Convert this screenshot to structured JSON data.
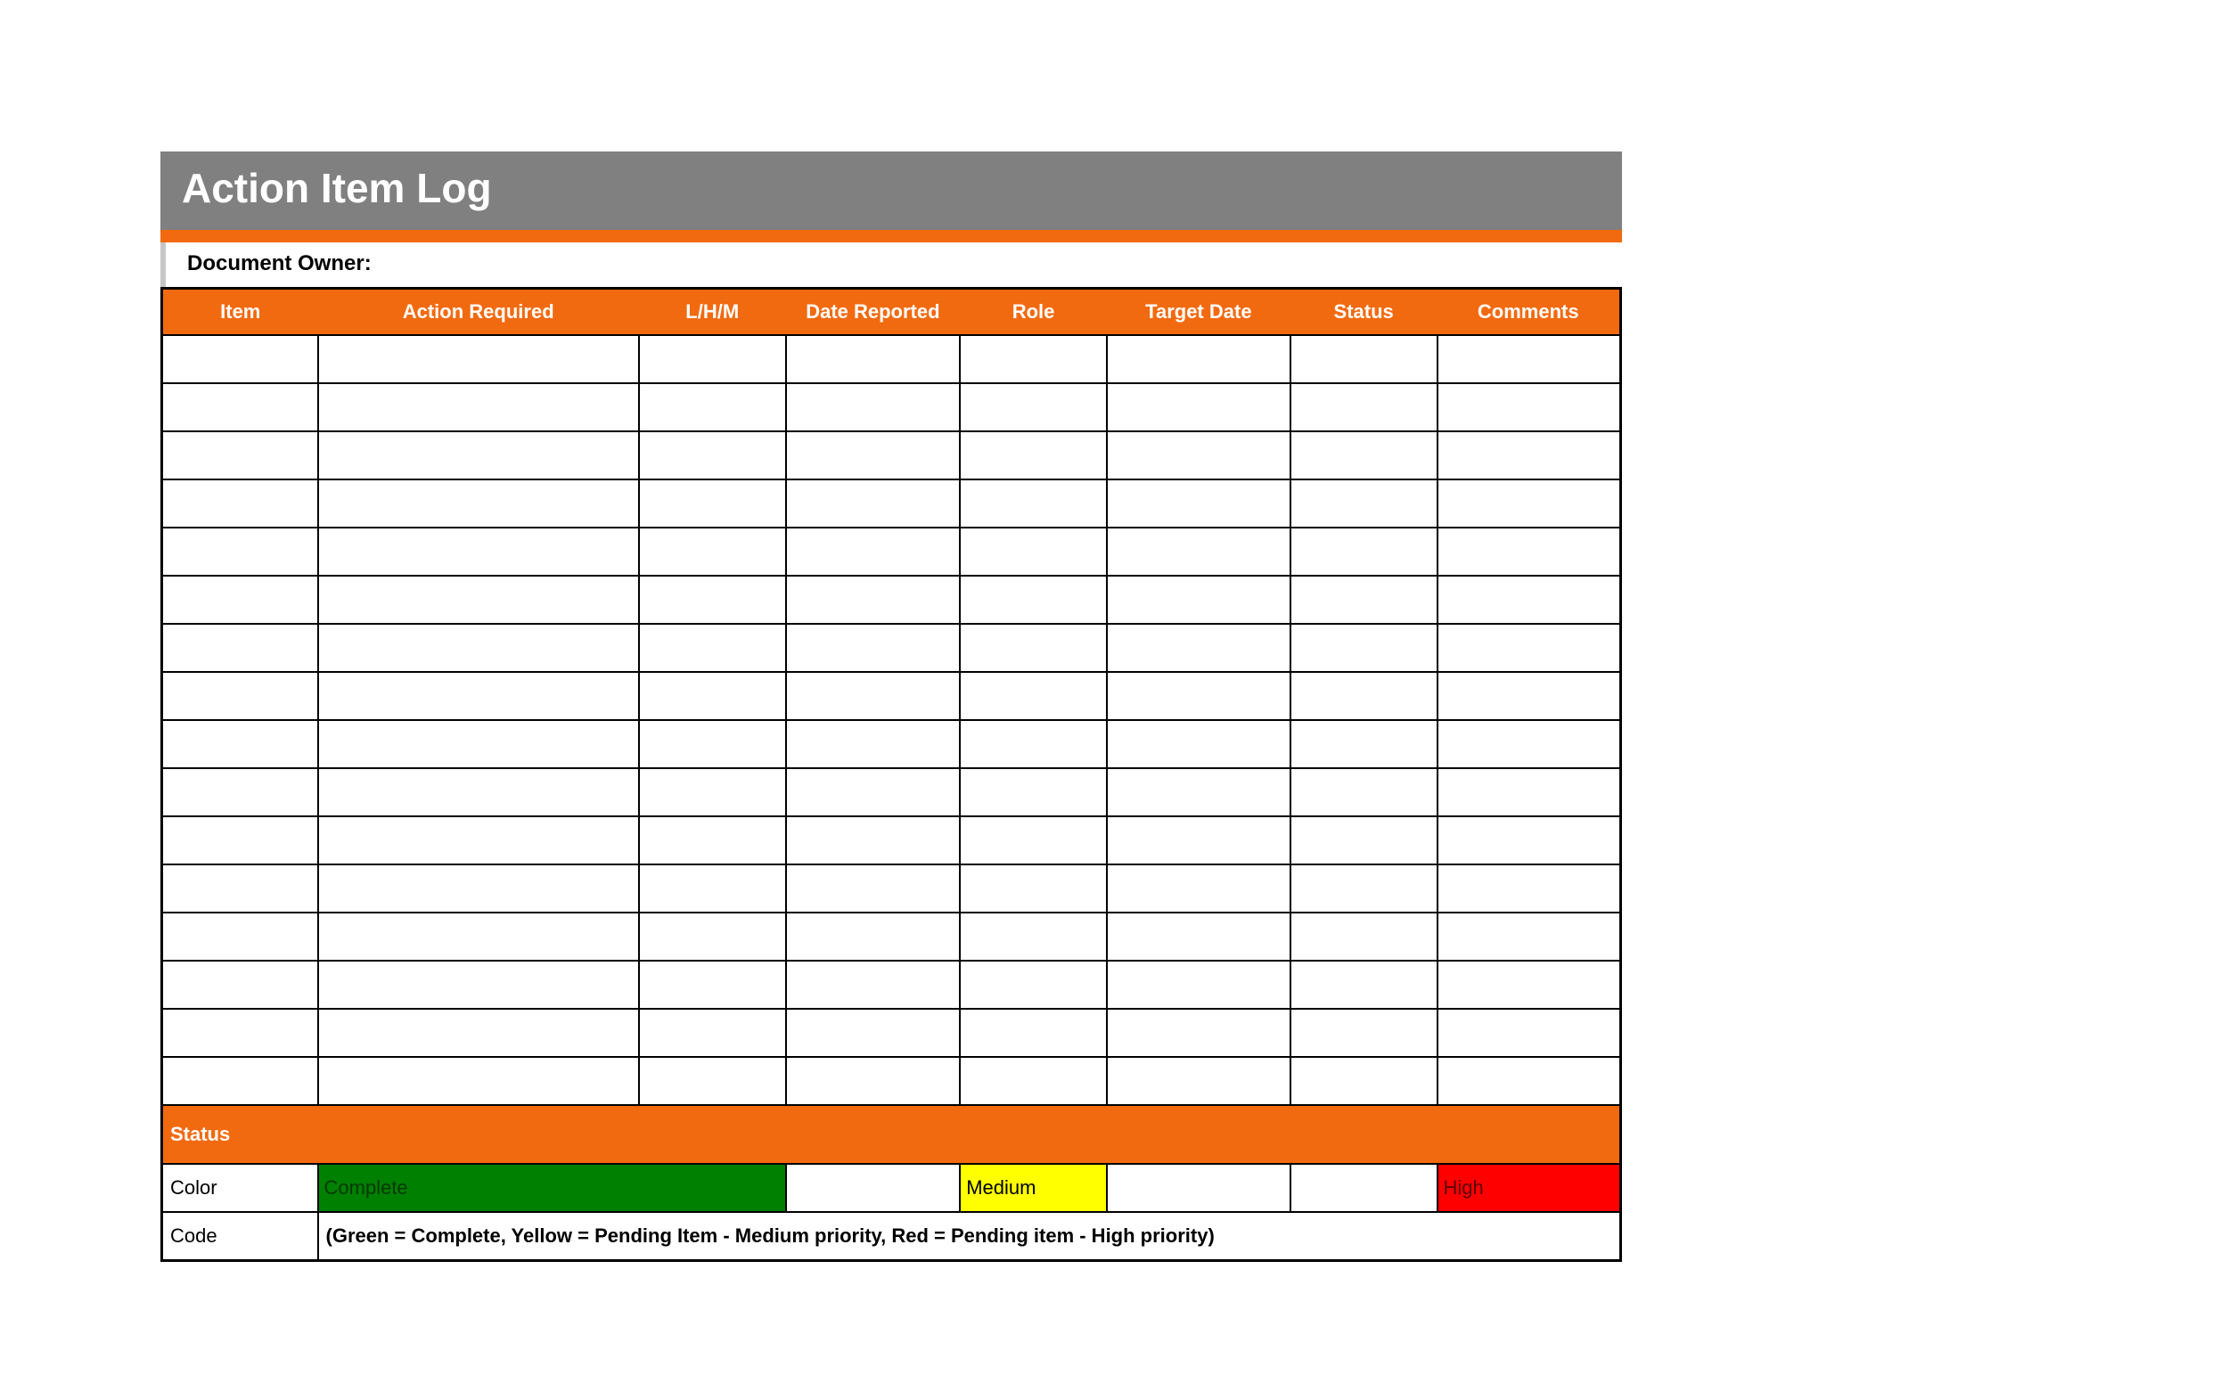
{
  "title": "Action Item Log",
  "document_owner_label": "Document Owner:",
  "columns": [
    "Item",
    "Action Required",
    "L/H/M",
    "Date Reported",
    "Role",
    "Target Date",
    "Status",
    "Comments"
  ],
  "rows": [
    [
      "",
      "",
      "",
      "",
      "",
      "",
      "",
      ""
    ],
    [
      "",
      "",
      "",
      "",
      "",
      "",
      "",
      ""
    ],
    [
      "",
      "",
      "",
      "",
      "",
      "",
      "",
      ""
    ],
    [
      "",
      "",
      "",
      "",
      "",
      "",
      "",
      ""
    ],
    [
      "",
      "",
      "",
      "",
      "",
      "",
      "",
      ""
    ],
    [
      "",
      "",
      "",
      "",
      "",
      "",
      "",
      ""
    ],
    [
      "",
      "",
      "",
      "",
      "",
      "",
      "",
      ""
    ],
    [
      "",
      "",
      "",
      "",
      "",
      "",
      "",
      ""
    ],
    [
      "",
      "",
      "",
      "",
      "",
      "",
      "",
      ""
    ],
    [
      "",
      "",
      "",
      "",
      "",
      "",
      "",
      ""
    ],
    [
      "",
      "",
      "",
      "",
      "",
      "",
      "",
      ""
    ],
    [
      "",
      "",
      "",
      "",
      "",
      "",
      "",
      ""
    ],
    [
      "",
      "",
      "",
      "",
      "",
      "",
      "",
      ""
    ],
    [
      "",
      "",
      "",
      "",
      "",
      "",
      "",
      ""
    ],
    [
      "",
      "",
      "",
      "",
      "",
      "",
      "",
      ""
    ],
    [
      "",
      "",
      "",
      "",
      "",
      "",
      "",
      ""
    ]
  ],
  "status_header": "Status",
  "legend": {
    "color_label": "Color",
    "code_label": "Code",
    "complete_label": "Complete",
    "medium_label": "Medium",
    "high_label": "High",
    "code_text": "(Green = Complete, Yellow = Pending Item - Medium priority,  Red = Pending item - High priority)"
  },
  "colors": {
    "header_gray": "#808080",
    "orange": "#f26a0f",
    "green": "#008000",
    "yellow": "#ffff00",
    "red": "#ff0000"
  }
}
